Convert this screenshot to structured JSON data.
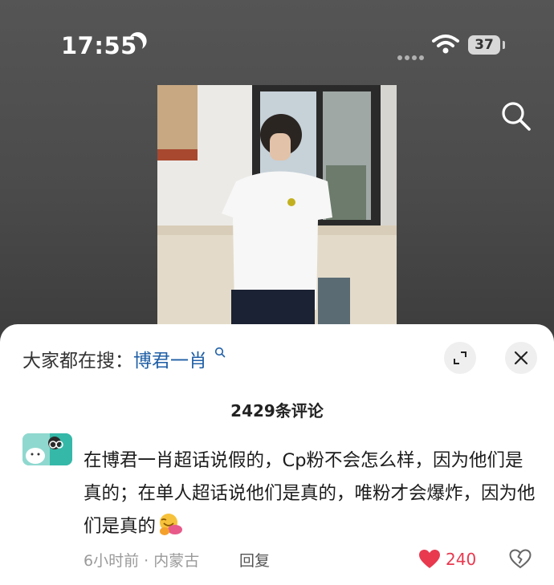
{
  "status_bar": {
    "time": "17:55",
    "battery": "37",
    "icons": [
      "moon-icon",
      "signal-icon",
      "wifi-icon",
      "battery-icon"
    ]
  },
  "header": {
    "search_icon": "search-icon"
  },
  "sheet": {
    "trending_prefix": "大家都在搜：",
    "trending_keyword": "博君一肖",
    "comment_count": "2429条评论",
    "icons": [
      "expand-icon",
      "close-icon"
    ]
  },
  "comment": {
    "text": "在博君一肖超话说假的，Cp粉不会怎么样，因为他们是真的；在单人超话说他们是真的，唯粉才会爆炸，因为他们是真的",
    "time_location": "6小时前 · 内蒙古",
    "reply_label": "回复",
    "like_count": "240"
  },
  "colors": {
    "link": "#1f5fa6",
    "like": "#e8394f",
    "meta": "#9a9a9a"
  }
}
